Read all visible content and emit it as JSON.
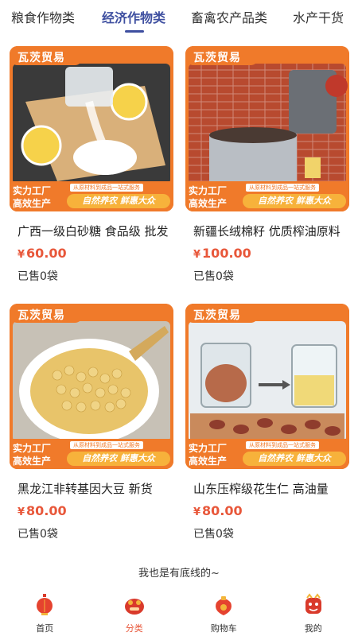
{
  "tabs": [
    {
      "label": "粮食作物类"
    },
    {
      "label": "经济作物类"
    },
    {
      "label": "畜禽农产品类"
    },
    {
      "label": "水产干货"
    }
  ],
  "card_overlay": {
    "brand": "瓦茨贸易",
    "promo_line1": "实力工厂",
    "promo_line2": "高效生产",
    "promo_small": "从原材料到成品一站式服务",
    "promo_strip": "自然养农 鲜惠大众"
  },
  "products": [
    {
      "title": "广西一级白砂糖 食品级 批发",
      "currency": "¥",
      "price": "60.00",
      "sold": "已售0袋"
    },
    {
      "title": "新疆长绒棉籽 优质榨油原料",
      "currency": "¥",
      "price": "100.00",
      "sold": "已售0袋"
    },
    {
      "title": "黑龙江非转基因大豆 新货",
      "currency": "¥",
      "price": "80.00",
      "sold": "已售0袋"
    },
    {
      "title": "山东压榨级花生仁 高油量",
      "currency": "¥",
      "price": "80.00",
      "sold": "已售0袋"
    }
  ],
  "footer_note": "我也是有底线的~",
  "bottom_nav": [
    {
      "label": "首页",
      "icon": "home-lantern-icon"
    },
    {
      "label": "分类",
      "icon": "category-icon"
    },
    {
      "label": "购物车",
      "icon": "cart-bag-icon"
    },
    {
      "label": "我的",
      "icon": "profile-icon"
    }
  ],
  "colors": {
    "accent": "#3e4fa0",
    "price": "#e8573a",
    "brand_orange": "#f07a2a",
    "strip": "#f7b23b"
  }
}
